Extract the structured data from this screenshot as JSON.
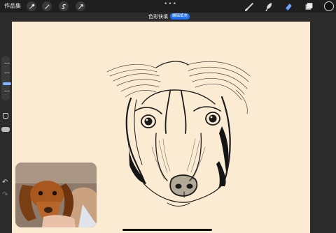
{
  "topbar": {
    "gallery_label": "作品集",
    "more_icon": "•••",
    "left_tools": [
      "wrench-icon",
      "magic-wand-icon",
      "selection-icon",
      "transform-icon"
    ],
    "right_tools": [
      "brush-icon",
      "smudge-icon",
      "eraser-icon",
      "layers-icon",
      "color-icon"
    ],
    "active_tool": "eraser-icon",
    "color": "#111111"
  },
  "status": {
    "text": "色彩快填",
    "pill": "编辑填充"
  },
  "canvas": {
    "background": "#fbebd2"
  },
  "sidebar": {
    "undo_icon": "↶",
    "redo_icon": "↷"
  },
  "colors": {
    "accent": "#1e6df0",
    "toolbar": "#1f1f1f",
    "workspace": "#2b2b2b",
    "eraser_active": "#6ea6ff"
  }
}
